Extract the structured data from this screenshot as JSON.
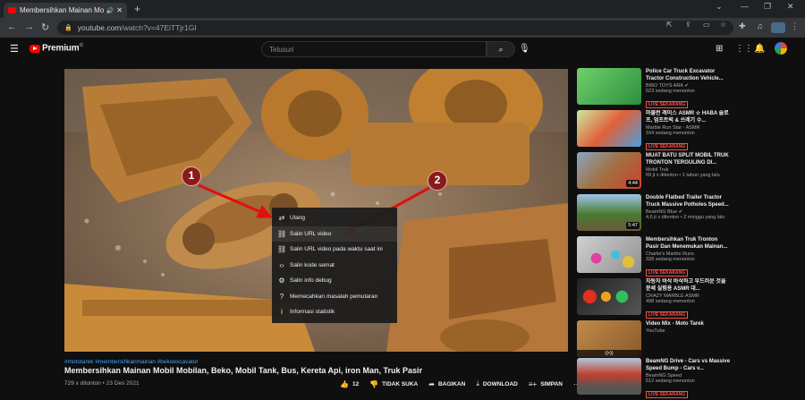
{
  "browser": {
    "tab_title": "Membersihkan Mainan Mobi",
    "tab_audio_icon": "speaker-icon",
    "url_domain": "youtube.com",
    "url_path": "/watch?v=47EiTTjr1GI"
  },
  "yt": {
    "brand": "Premium",
    "search_placeholder": "Telusuri"
  },
  "context_menu": [
    {
      "icon": "loop-icon",
      "glyph": "⇄",
      "label": "Ulang"
    },
    {
      "icon": "link-icon",
      "glyph": "⛓",
      "label": "Salin URL video"
    },
    {
      "icon": "link-icon",
      "glyph": "⛓",
      "label": "Salin URL video pada waktu saat ini"
    },
    {
      "icon": "embed-icon",
      "glyph": "‹›",
      "label": "Salin kode semat"
    },
    {
      "icon": "debug-icon",
      "glyph": "⚙",
      "label": "Salin info debug"
    },
    {
      "icon": "help-icon",
      "glyph": "?",
      "label": "Memecahkan masalah pemutaran"
    },
    {
      "icon": "info-icon",
      "glyph": "i",
      "label": "Informasi statistik"
    }
  ],
  "annotations": [
    "1",
    "2"
  ],
  "video": {
    "tags": "#mototarek #membersihkanmainan #bekoexcavator",
    "title": "Membersihkan Mainan Mobil Mobilan, Beko, Mobil Tank, Bus, Kereta Api, iron Man, Truk Pasir",
    "meta": "729 x ditonton • 23 Des 2021",
    "likes": "12",
    "dislike_label": "TIDAK SUKA",
    "share_label": "BAGIKAN",
    "download_label": "DOWNLOAD",
    "save_label": "SIMPAN"
  },
  "sidebar": [
    {
      "title": "Police Car Truck Excavator Tractor Construction Vehicle...",
      "channel": "BIBO TOYS ARA ✔",
      "views": "523 sedang menonton",
      "badge": "LIVE SEKARANG",
      "duration": "",
      "color": "#3aa35a"
    },
    {
      "title": "마블런 레이스 ASMR ☆ HABA 슬로프, 덤프트럭 & 쓰레기 수...",
      "channel": "Marble Run Star - ASMR",
      "views": "164 sedang menonton",
      "badge": "LIVE SEKARANG",
      "duration": "",
      "color": "#9acb6a"
    },
    {
      "title": "MUAT BATU SPLIT MOBIL TRUK TRONTON TERGULING DI...",
      "channel": "Mobil Truk",
      "views": "69 jt x ditonton • 1 tahun yang lalu",
      "badge": "",
      "duration": "4:44",
      "color": "#7a6a40"
    },
    {
      "title": "Double Flatbed Trailer Tractor Truck Massive Potholes Speed...",
      "channel": "BeamNG Blue ✔",
      "views": "4,6 jt x ditonton • 2 minggu yang lalu",
      "badge": "",
      "duration": "5:47",
      "color": "#5a7a3a"
    },
    {
      "title": "Membersihkan Truk Tronton Pasir Dan Menemukan Mainan...",
      "channel": "Charlie's Marble Runs",
      "views": "328 sedang menonton",
      "badge": "LIVE SEKARANG",
      "duration": "",
      "color": "#c0408a"
    },
    {
      "title": "자동차 바삭 바삭하고 부드러운 것을 분쇄 실험용 ASMR 대...",
      "channel": "CRAZY MARBLE ASMR",
      "views": "498 sedang menonton",
      "badge": "LIVE SEKARANG",
      "duration": "",
      "color": "#d04020"
    },
    {
      "title": "Video Mix - Moto Tarek",
      "channel": "YouTube",
      "views": "",
      "badge": "",
      "duration": "((•))",
      "color": "#b07a40"
    },
    {
      "title": "BeamNG Drive - Cars vs Massive Speed Bump - Cars v...",
      "channel": "BeamNG Speed",
      "views": "512 sedang menonton",
      "badge": "LIVE SEKARANG",
      "duration": "",
      "color": "#c04030"
    }
  ]
}
